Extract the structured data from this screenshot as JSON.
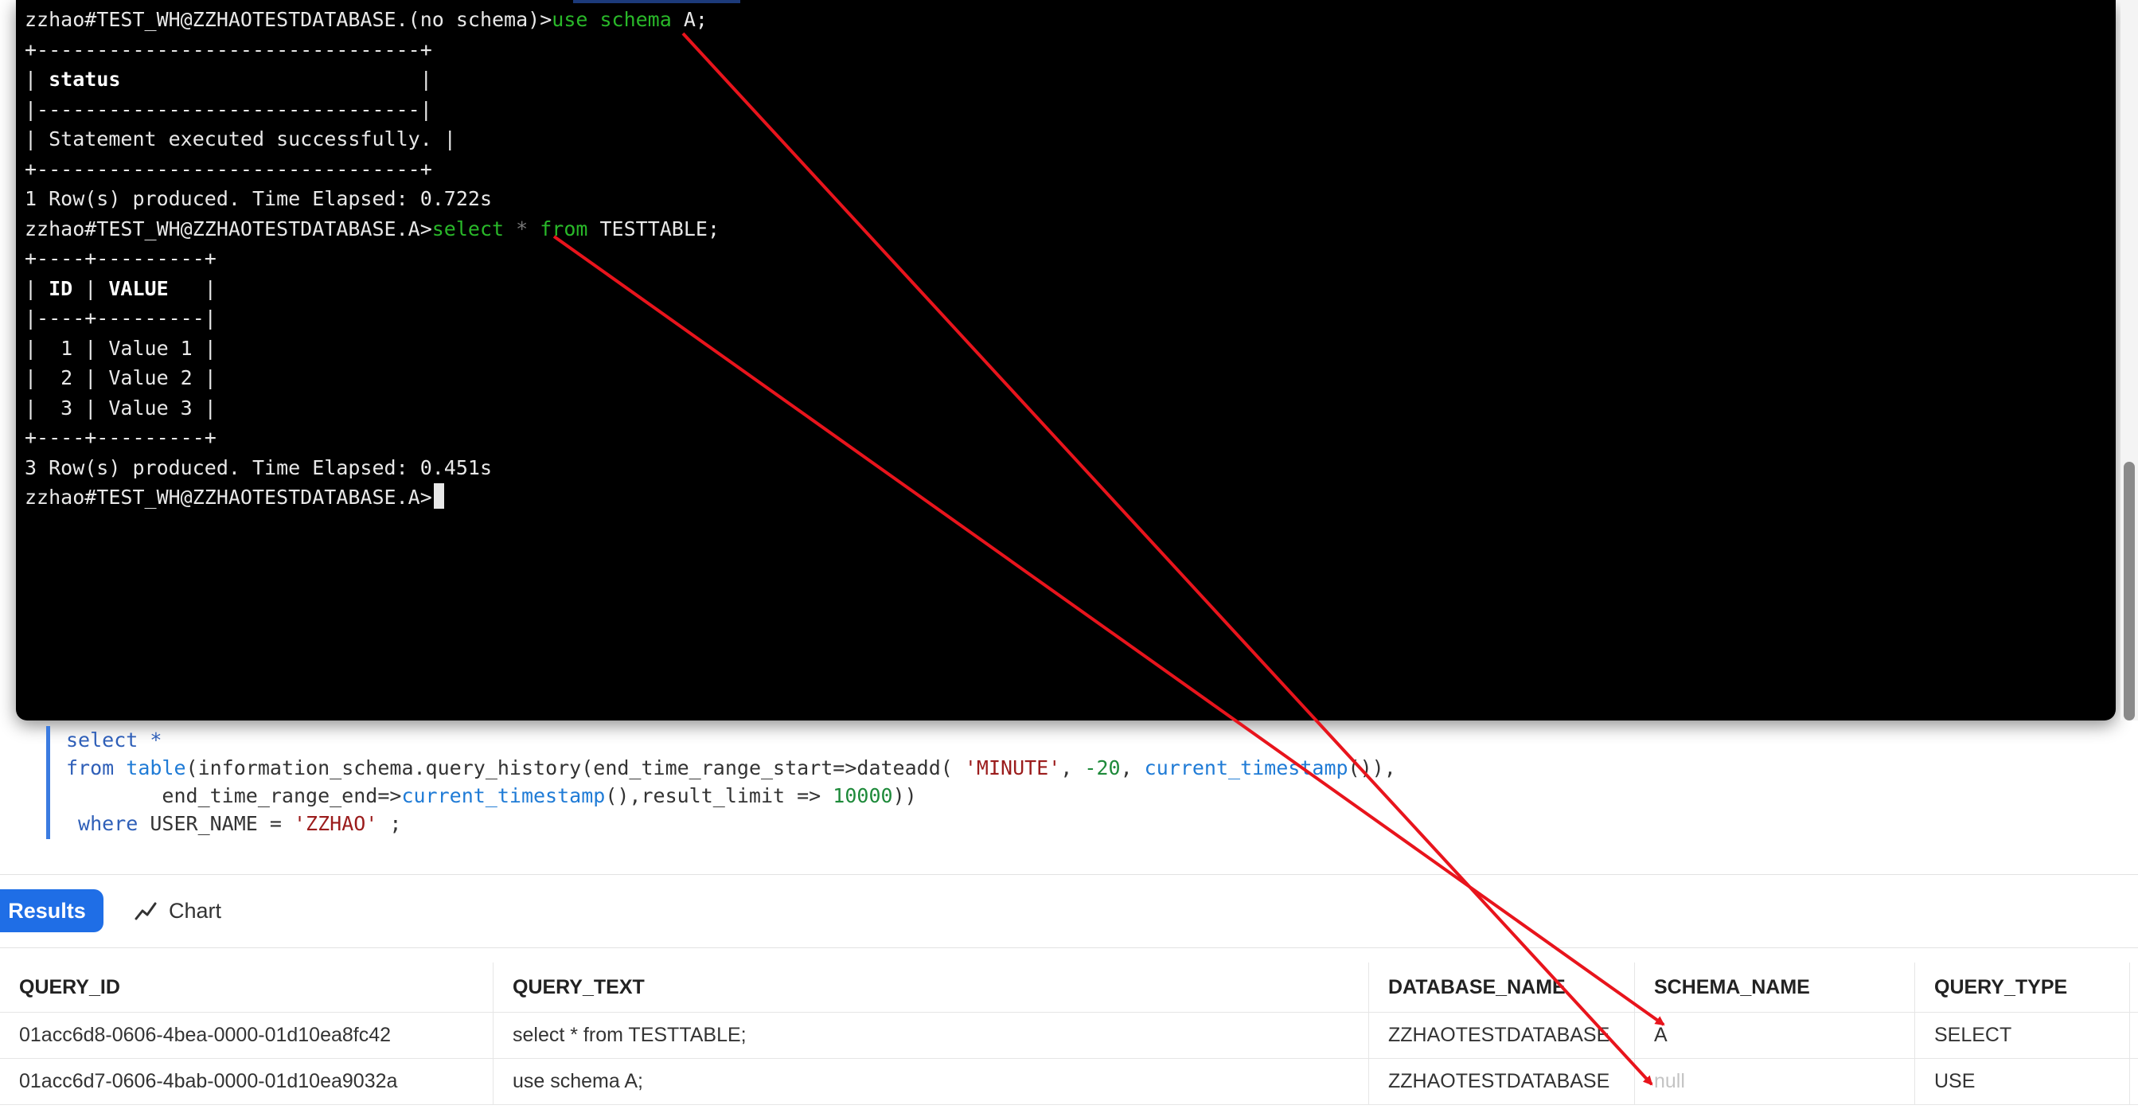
{
  "terminal": {
    "lines": [
      [
        {
          "t": "zzhao#TEST_WH@ZZHAOTESTDATABASE.(no schema)>"
        },
        {
          "t": "use schema",
          "c": "kw"
        },
        {
          "t": " A;"
        }
      ],
      [
        {
          "t": "+--------------------------------+"
        }
      ],
      [
        {
          "t": "| "
        },
        {
          "t": "status",
          "c": "bold"
        },
        {
          "t": "                         |"
        }
      ],
      [
        {
          "t": "|--------------------------------|"
        }
      ],
      [
        {
          "t": "| Statement executed successfully. |"
        }
      ],
      [
        {
          "t": "+--------------------------------+"
        }
      ],
      [
        {
          "t": "1 Row(s) produced. Time Elapsed: 0.722s"
        }
      ],
      [
        {
          "t": "zzhao#TEST_WH@ZZHAOTESTDATABASE.A>"
        },
        {
          "t": "select",
          "c": "kw"
        },
        {
          "t": " * ",
          "c": "dim"
        },
        {
          "t": "from",
          "c": "kw"
        },
        {
          "t": " TESTTABLE;"
        }
      ],
      [
        {
          "t": "+----+---------+"
        }
      ],
      [
        {
          "t": "| "
        },
        {
          "t": "ID",
          "c": "bold"
        },
        {
          "t": " | "
        },
        {
          "t": "VALUE",
          "c": "bold"
        },
        {
          "t": "   |"
        }
      ],
      [
        {
          "t": "|----+---------|"
        }
      ],
      [
        {
          "t": "|  1 | Value 1 |"
        }
      ],
      [
        {
          "t": "|  2 | Value 2 |"
        }
      ],
      [
        {
          "t": "|  3 | Value 3 |"
        }
      ],
      [
        {
          "t": "+----+---------+"
        }
      ],
      [
        {
          "t": "3 Row(s) produced. Time Elapsed: 0.451s"
        }
      ],
      [
        {
          "t": "zzhao#TEST_WH@ZZHAOTESTDATABASE.A>"
        }
      ]
    ]
  },
  "sql_editor": {
    "lines": [
      [
        {
          "t": "select *",
          "c": "s-kw"
        }
      ],
      [
        {
          "t": "from ",
          "c": "s-kw"
        },
        {
          "t": "table",
          "c": "s-fn"
        },
        {
          "t": "(information_schema.query_history(end_time_range_start=>dateadd( "
        },
        {
          "t": "'MINUTE'",
          "c": "s-str"
        },
        {
          "t": ", "
        },
        {
          "t": "-20",
          "c": "s-num"
        },
        {
          "t": ", "
        },
        {
          "t": "current_timestamp",
          "c": "s-fn"
        },
        {
          "t": "()),"
        }
      ],
      [
        {
          "t": "        end_time_range_end=>"
        },
        {
          "t": "current_timestamp",
          "c": "s-fn"
        },
        {
          "t": "(),result_limit => "
        },
        {
          "t": "10000",
          "c": "s-num"
        },
        {
          "t": "))"
        }
      ],
      [
        {
          "t": " where ",
          "c": "s-kw"
        },
        {
          "t": "USER_NAME = "
        },
        {
          "t": "'ZZHAO'",
          "c": "s-str"
        },
        {
          "t": " ;"
        }
      ]
    ]
  },
  "tabs": {
    "results": "Results",
    "chart": "Chart"
  },
  "results_table": {
    "columns": [
      "QUERY_ID",
      "QUERY_TEXT",
      "DATABASE_NAME",
      "SCHEMA_NAME",
      "QUERY_TYPE"
    ],
    "rows": [
      {
        "query_id": "01acc6d8-0606-4bea-0000-01d10ea8fc42",
        "query_text": "select * from TESTTABLE;",
        "database_name": "ZZHAOTESTDATABASE",
        "schema_name": "A",
        "query_type": "SELECT"
      },
      {
        "query_id": "01acc6d7-0606-4bab-0000-01d10ea9032a",
        "query_text": "use schema A;",
        "database_name": "ZZHAOTESTDATABASE",
        "schema_name": "null",
        "query_type": "USE"
      }
    ]
  },
  "annotation_color": "#e8141c"
}
